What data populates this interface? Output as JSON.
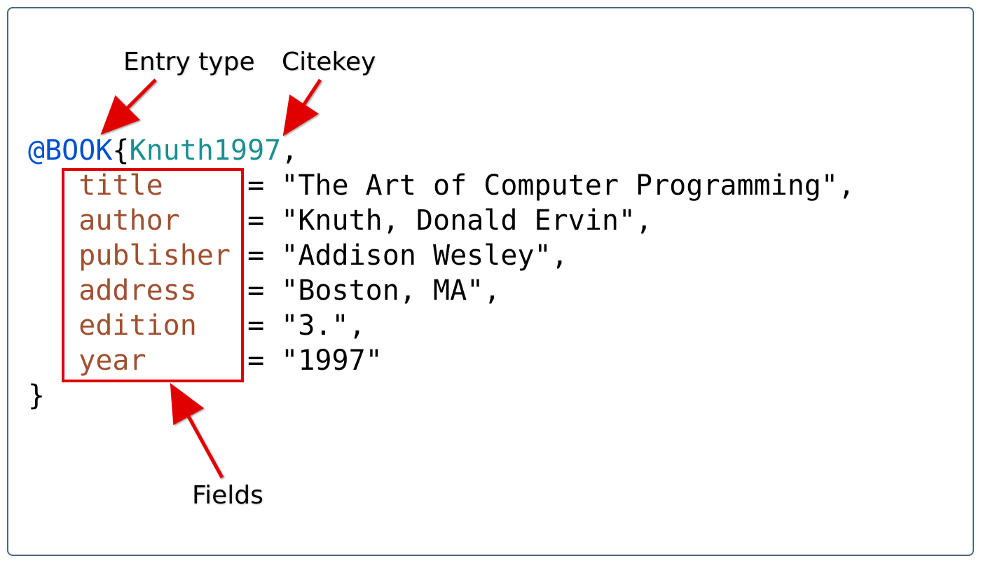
{
  "labels": {
    "entry_type": "Entry type",
    "citekey": "Citekey",
    "fields": "Fields"
  },
  "bibtex": {
    "at": "@",
    "type": "BOOK",
    "open_brace": "{",
    "citekey": "Knuth1997",
    "comma": ",",
    "close_brace": "}",
    "eq": " = ",
    "q": "\"",
    "indent": "   ",
    "field_pad": {
      "title": "title    ",
      "author": "author   ",
      "publisher": "publisher",
      "address": "address  ",
      "edition": "edition  ",
      "year": "year     "
    },
    "fields": {
      "title": "The Art of Computer Programming",
      "author": "Knuth, Donald Ervin",
      "publisher": "Addison Wesley",
      "address": "Boston, MA",
      "edition": "3.",
      "year": "1997"
    }
  }
}
